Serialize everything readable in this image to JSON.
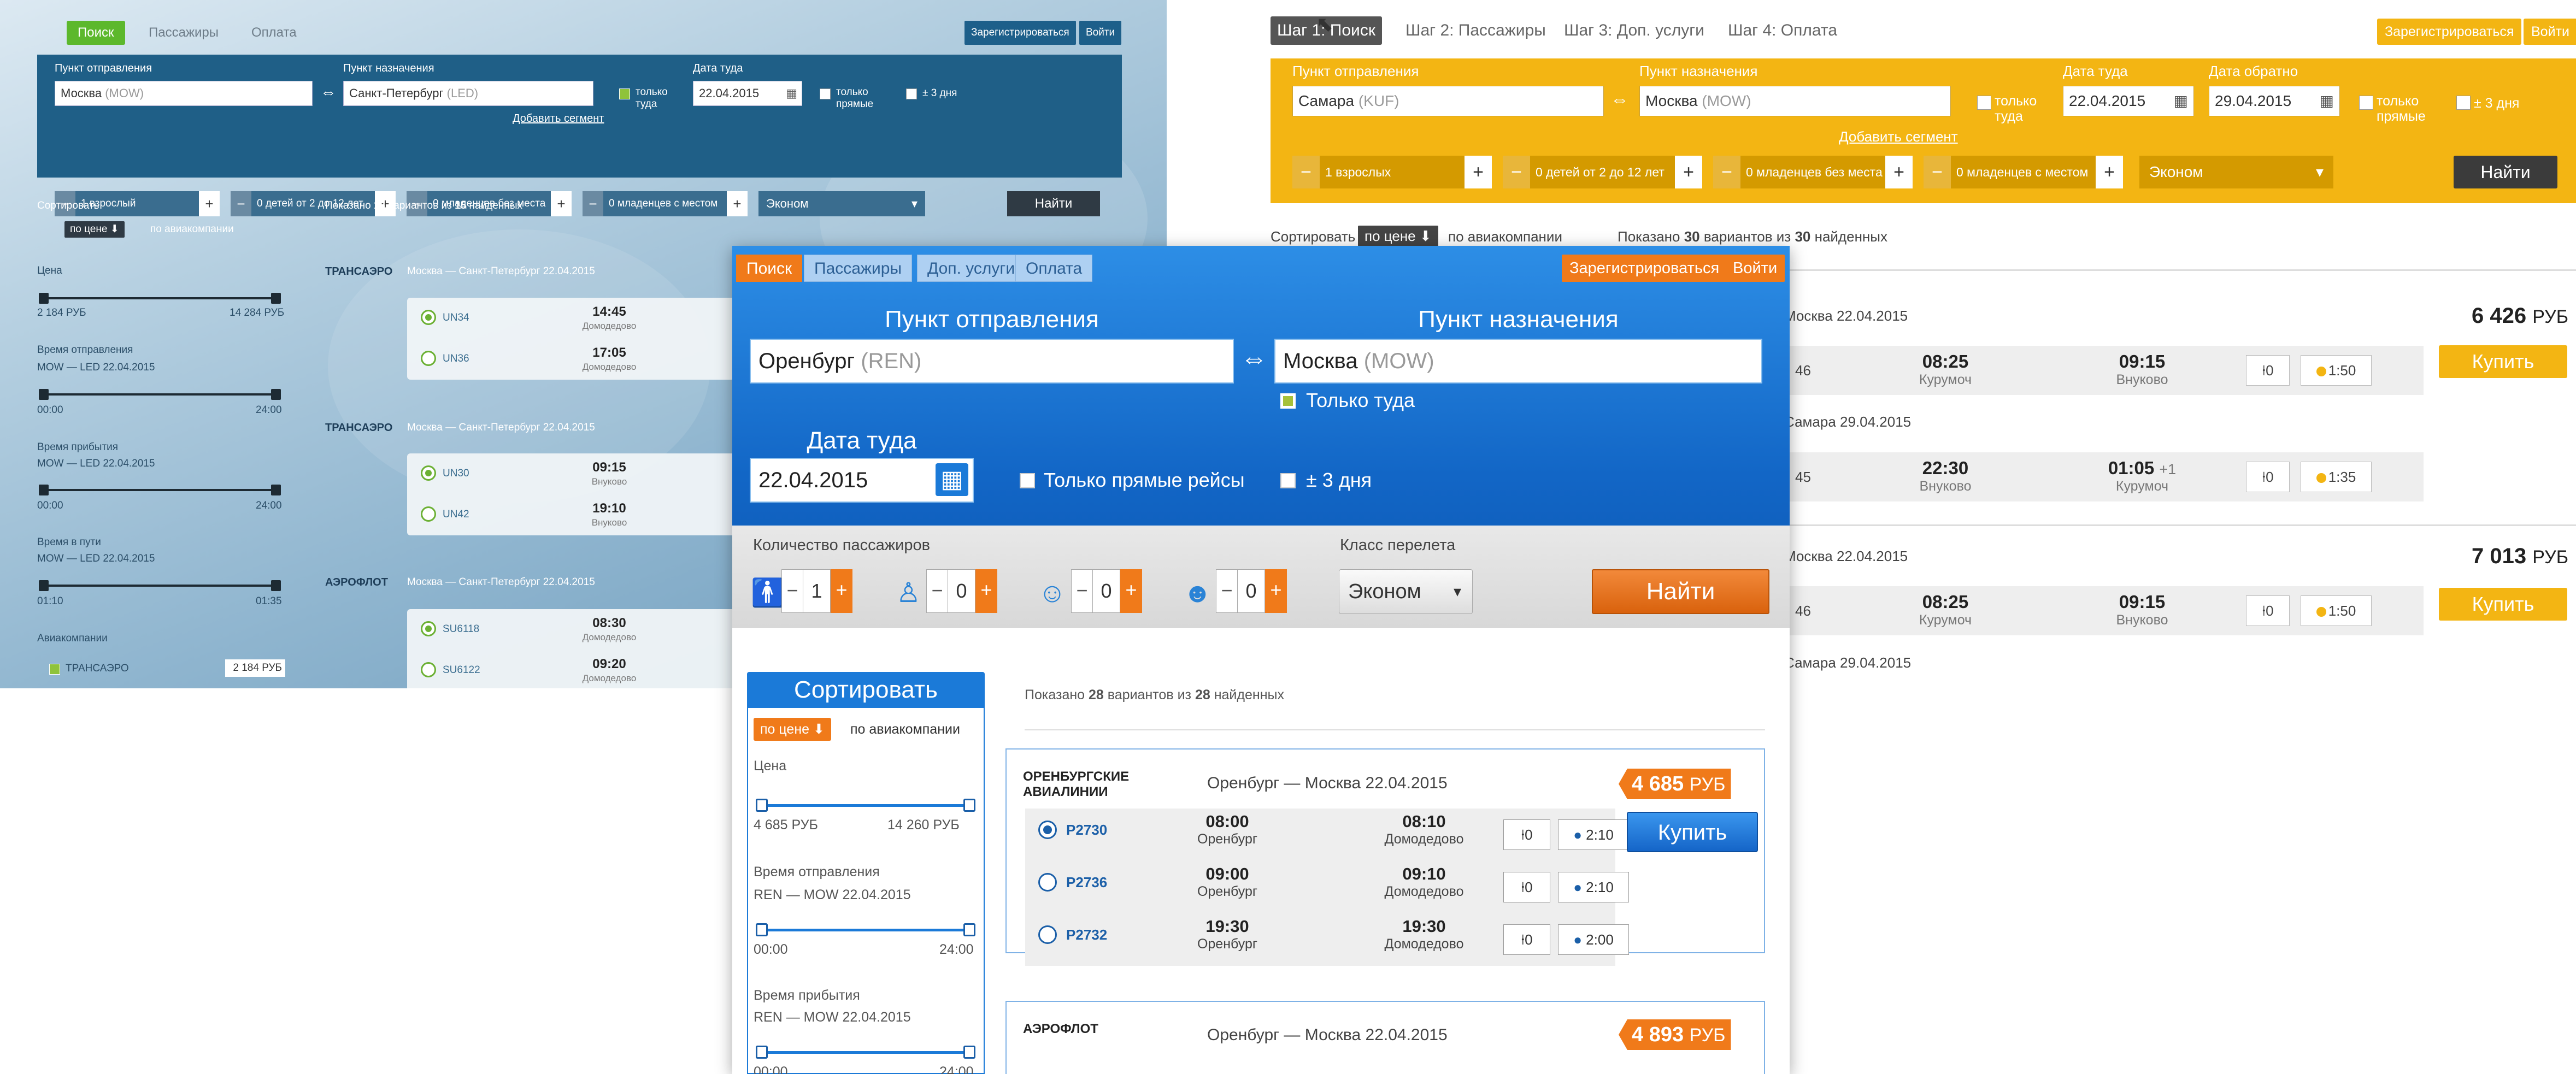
{
  "winA": {
    "tabs": [
      "Поиск",
      "Пассажиры",
      "Оплата"
    ],
    "register": "Зарегистрироваться",
    "login": "Войти",
    "from_label": "Пункт отправления",
    "from_city": "Москва",
    "from_code": "(MOW)",
    "to_label": "Пункт назначения",
    "to_city": "Санкт-Петербург",
    "to_code": "(LED)",
    "only_there_1": "только",
    "only_there_2": "туда",
    "date_label": "Дата туда",
    "date_value": "22.04.2015",
    "direct_1": "только",
    "direct_2": "прямые",
    "pm3": "± 3 дня",
    "add_segment": "Добавить сегмент",
    "adults": "1 взрослый",
    "children": "0 детей от 2 до 12 лет",
    "infants_noseat": "0 младенцев без места",
    "infants_seat": "0 младенцев с местом",
    "class": "Эконом",
    "find": "Найти",
    "sort_label": "Сортировать",
    "sort_price": "по цене",
    "sort_airline": "по авиакомпании",
    "shown_pre": "Показано",
    "shown_n": "13",
    "shown_mid": "вариантов из",
    "shown_total": "15",
    "shown_post": "найденных",
    "filters": {
      "price": "Цена",
      "price_min": "2 184 РУБ",
      "price_max": "14 284 РУБ",
      "dep_time": "Время отправления",
      "dep_route": "MOW — LED 22.04.2015",
      "dep_min": "00:00",
      "dep_max": "24:00",
      "arr_time": "Время прибытия",
      "arr_route": "MOW — LED 22.04.2015",
      "arr_min": "00:00",
      "arr_max": "24:00",
      "travel_time": "Время в пути",
      "travel_route": "MOW — LED 22.04.2015",
      "travel_min": "01:10",
      "travel_max": "01:35",
      "airlines": "Авиакомпании",
      "airline1": "ТРАНСАЭРО",
      "airline1_price": "2 184 РУБ"
    },
    "results": [
      {
        "airline": "ТРАНСАЭРО",
        "route": "Москва — Санкт-Петербург 22.04.2015",
        "flights": [
          {
            "fn": "UN34",
            "time": "14:45",
            "ap": "Домодедово"
          },
          {
            "fn": "UN36",
            "time": "17:05",
            "ap": "Домодедово"
          }
        ]
      },
      {
        "airline": "ТРАНСАЭРО",
        "route": "Москва — Санкт-Петербург 22.04.2015",
        "flights": [
          {
            "fn": "UN30",
            "time": "09:15",
            "ap": "Внуково"
          },
          {
            "fn": "UN42",
            "time": "19:10",
            "ap": "Внуково"
          }
        ]
      },
      {
        "airline": "АЭРОФЛОТ",
        "route": "Москва — Санкт-Петербург 22.04.2015",
        "flights": [
          {
            "fn": "SU6118",
            "time": "08:30",
            "ap": "Домодедово"
          },
          {
            "fn": "SU6122",
            "time": "09:20",
            "ap": "Домодедово"
          }
        ]
      }
    ]
  },
  "winB": {
    "steps": [
      "Шаг 1: Поиск",
      "Шаг 2: Пассажиры",
      "Шаг 3: Доп. услуги",
      "Шаг 4: Оплата"
    ],
    "register": "Зарегистрироваться",
    "login": "Войти",
    "from_label": "Пункт отправления",
    "from_city": "Самара",
    "from_code": "(KUF)",
    "to_label": "Пункт назначения",
    "to_city": "Москва",
    "to_code": "(MOW)",
    "only_there_1": "только",
    "only_there_2": "туда",
    "date_label": "Дата туда",
    "date_value": "22.04.2015",
    "return_label": "Дата обратно",
    "return_value": "29.04.2015",
    "direct_1": "только",
    "direct_2": "прямые",
    "pm3": "± 3 дня",
    "add_segment": "Добавить сегмент",
    "adults": "1 взрослых",
    "children": "0 детей от 2 до 12 лет",
    "infants_noseat": "0 младенцев без места",
    "infants_seat": "0 младенцев с местом",
    "class": "Эконом",
    "find": "Найти",
    "sort_label": "Сортировать",
    "sort_price": "по цене",
    "sort_airline": "по авиакомпании",
    "shown_pre": "Показано",
    "shown_n": "30",
    "shown_mid": "вариантов из",
    "shown_total": "30",
    "shown_post": "найденных",
    "offers": [
      {
        "out_route": "Москва 22.04.2015",
        "price": "6 426",
        "cur": "РУБ",
        "buy": "Купить",
        "out": {
          "fn": "46",
          "dep": "08:25",
          "dep_ap": "Курумоч",
          "arr": "09:15",
          "arr_ap": "Внуково",
          "stops": "0",
          "dur": "1:50"
        },
        "back_route": "Самара 29.04.2015",
        "back": {
          "fn": "45",
          "dep": "22:30",
          "dep_ap": "Внуково",
          "arr": "01:05",
          "arr_plus": "+1",
          "arr_ap": "Курумоч",
          "stops": "0",
          "dur": "1:35"
        }
      },
      {
        "out_route": "Москва 22.04.2015",
        "price": "7 013",
        "cur": "РУБ",
        "buy": "Купить",
        "out": {
          "fn": "46",
          "dep": "08:25",
          "dep_ap": "Курумоч",
          "arr": "09:15",
          "arr_ap": "Внуково",
          "stops": "0",
          "dur": "1:50"
        },
        "back_route": "Самара 29.04.2015"
      }
    ]
  },
  "winC": {
    "tabs": [
      "Поиск",
      "Пассажиры",
      "Доп. услуги",
      "Оплата"
    ],
    "register": "Зарегистрироваться",
    "login": "Войти",
    "from_label": "Пункт отправления",
    "from_city": "Оренбург",
    "from_code": "(REN)",
    "to_label": "Пункт назначения",
    "to_city": "Москва",
    "to_code": "(MOW)",
    "only_there": "Только туда",
    "date_label": "Дата туда",
    "date_value": "22.04.2015",
    "direct": "Только прямые рейсы",
    "pm3": "± 3 дня",
    "pax_label": "Количество пассажиров",
    "pax_values": [
      "1",
      "0",
      "0",
      "0"
    ],
    "class_label": "Класс перелета",
    "class": "Эконом",
    "find": "Найти",
    "sort_title": "Сортировать",
    "sort_price": "по цене",
    "sort_airline": "по авиакомпании",
    "price_label": "Цена",
    "price_min": "4 685 РУБ",
    "price_max": "14 260 РУБ",
    "dep_label": "Время отправления",
    "dep_route": "REN — MOW 22.04.2015",
    "dep_min": "00:00",
    "dep_max": "24:00",
    "arr_label": "Время прибытия",
    "arr_route": "REN — MOW 22.04.2015",
    "arr_min": "00:00",
    "arr_max": "24:00",
    "shown_pre": "Показано",
    "shown_n": "28",
    "shown_mid": "вариантов из",
    "shown_total": "28",
    "shown_post": "найденных",
    "offers": [
      {
        "airline_1": "ОРЕНБУРГСКИЕ",
        "airline_2": "АВИАЛИНИИ",
        "route": "Оренбург — Москва 22.04.2015",
        "price": "4 685",
        "cur": "РУБ",
        "buy": "Купить",
        "flights": [
          {
            "fn": "P2730",
            "dep": "08:00",
            "dep_ap": "Оренбург",
            "arr": "08:10",
            "arr_ap": "Домодедово",
            "stops": "0",
            "dur": "2:10"
          },
          {
            "fn": "P2736",
            "dep": "09:00",
            "dep_ap": "Оренбург",
            "arr": "09:10",
            "arr_ap": "Домодедово",
            "stops": "0",
            "dur": "2:10"
          },
          {
            "fn": "P2732",
            "dep": "19:30",
            "dep_ap": "Оренбург",
            "arr": "19:30",
            "arr_ap": "Домодедово",
            "stops": "0",
            "dur": "2:00"
          }
        ]
      },
      {
        "airline_1": "АЭРОФЛОТ",
        "route": "Оренбург — Москва 22.04.2015",
        "price": "4 893",
        "cur": "РУБ"
      }
    ]
  }
}
